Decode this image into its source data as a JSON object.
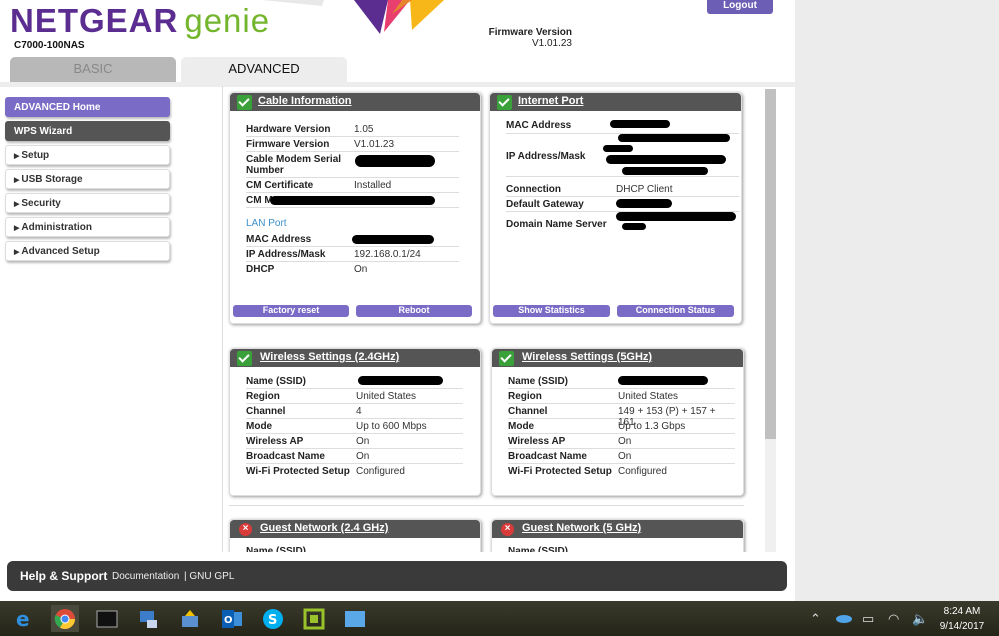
{
  "header": {
    "brand": "NETGEAR",
    "brand_suffix": "genie",
    "model": "C7000-100NAS",
    "logout_label": "Logout",
    "firmware_label": "Firmware Version",
    "firmware_value": "V1.01.23"
  },
  "tabs": [
    {
      "label": "BASIC"
    },
    {
      "label": "ADVANCED"
    }
  ],
  "sidebar": {
    "items": [
      {
        "label": "ADVANCED Home"
      },
      {
        "label": "WPS Wizard"
      },
      {
        "label": "Setup"
      },
      {
        "label": "USB Storage"
      },
      {
        "label": "Security"
      },
      {
        "label": "Administration"
      },
      {
        "label": "Advanced Setup"
      }
    ]
  },
  "cable": {
    "title": "Cable Information",
    "rows": [
      {
        "k": "Hardware Version",
        "v": "1.05"
      },
      {
        "k": "Firmware Version",
        "v": "V1.01.23"
      },
      {
        "k": "Cable Modem Serial Number",
        "v": ""
      },
      {
        "k": "CM Certificate",
        "v": "Installed"
      },
      {
        "k": "CM MAC",
        "v": ""
      }
    ],
    "lan_label": "LAN Port",
    "lan_rows": [
      {
        "k": "MAC Address",
        "v": ""
      },
      {
        "k": "IP Address/Mask",
        "v": "192.168.0.1/24"
      },
      {
        "k": "DHCP",
        "v": "On"
      }
    ],
    "factory_reset": "Factory reset",
    "reboot": "Reboot"
  },
  "internet": {
    "title": "Internet Port",
    "rows": [
      {
        "k": "MAC Address",
        "v": ""
      },
      {
        "k": "IP Address/Mask",
        "v": ""
      },
      {
        "k": "Connection",
        "v": "DHCP Client"
      },
      {
        "k": "Default Gateway",
        "v": ""
      },
      {
        "k": "Domain Name Server",
        "v": ""
      }
    ],
    "show_stats": "Show Statistics",
    "conn_status": "Connection Status"
  },
  "wifi24": {
    "title": "Wireless Settings (2.4GHz)",
    "rows": [
      {
        "k": "Name (SSID)",
        "v": ""
      },
      {
        "k": "Region",
        "v": "United States"
      },
      {
        "k": "Channel",
        "v": "4"
      },
      {
        "k": "Mode",
        "v": "Up to 600 Mbps"
      },
      {
        "k": "Wireless AP",
        "v": "On"
      },
      {
        "k": "Broadcast Name",
        "v": "On"
      },
      {
        "k": "Wi-Fi Protected Setup",
        "v": "Configured"
      }
    ]
  },
  "wifi5": {
    "title": "Wireless Settings (5GHz)",
    "rows": [
      {
        "k": "Name (SSID)",
        "v": ""
      },
      {
        "k": "Region",
        "v": "United States"
      },
      {
        "k": "Channel",
        "v": "149 + 153 (P) + 157 + 161"
      },
      {
        "k": "Mode",
        "v": "Up to 1.3 Gbps"
      },
      {
        "k": "Wireless AP",
        "v": "On"
      },
      {
        "k": "Broadcast Name",
        "v": "On"
      },
      {
        "k": "Wi-Fi Protected Setup",
        "v": "Configured"
      }
    ]
  },
  "guest24": {
    "title": "Guest Network (2.4 GHz)",
    "first_row": "Name (SSID)"
  },
  "guest5": {
    "title": "Guest Network (5 GHz)",
    "first_row": "Name (SSID)"
  },
  "footer": {
    "help": "Help & Support",
    "documentation": "Documentation",
    "gpl": "| GNU GPL"
  },
  "taskbar": {
    "time": "8:24 AM",
    "date": "9/14/2017",
    "icons": [
      "edge-icon",
      "chrome-icon",
      "cmd-icon",
      "network-app-icon",
      "upload-app-icon",
      "outlook-icon",
      "skype-icon",
      "citrix-icon",
      "window-app-icon"
    ]
  },
  "colors": {
    "purple": "#5c2d91",
    "green": "#73b52c",
    "accent": "#7a6cc6"
  }
}
